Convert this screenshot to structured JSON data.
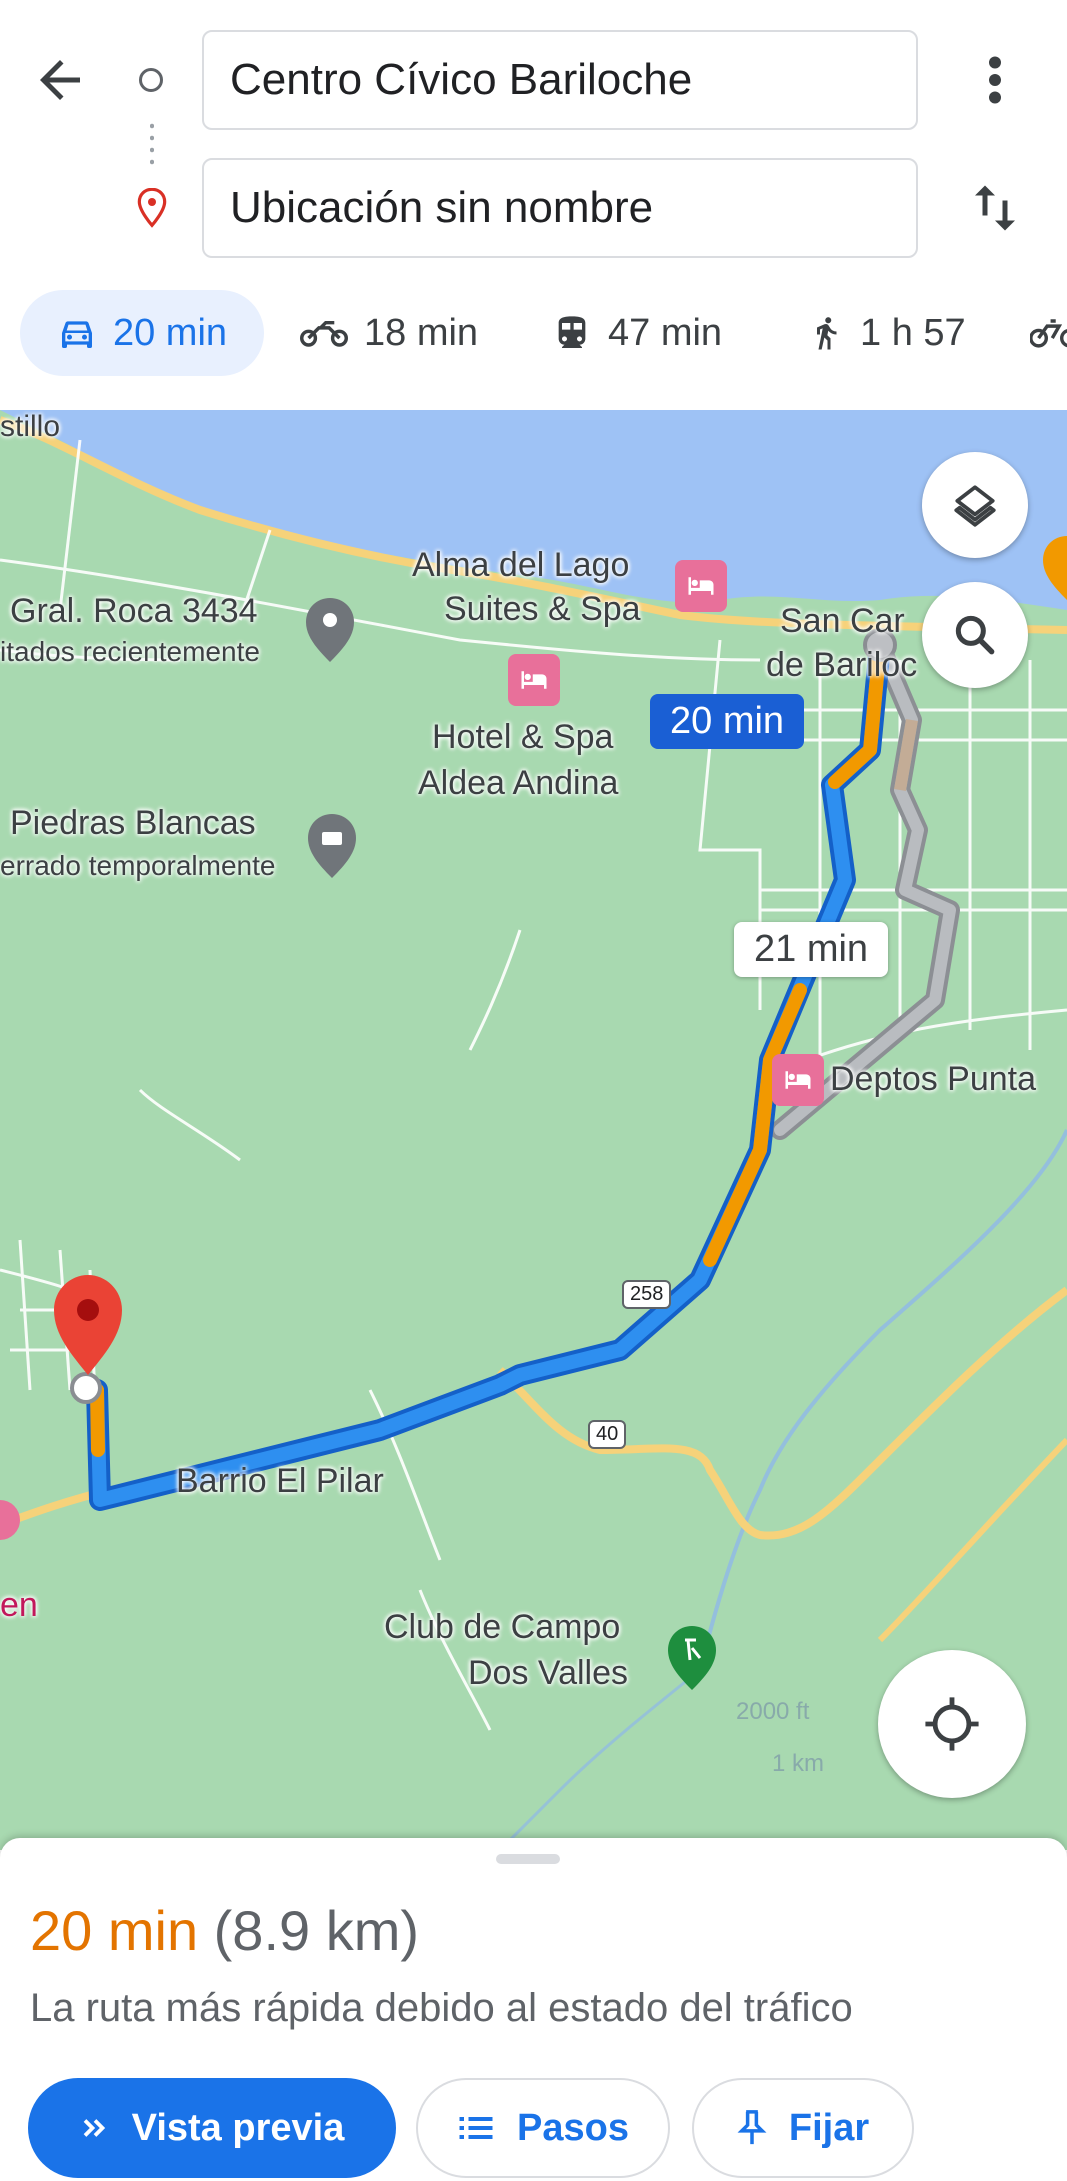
{
  "header": {
    "back_icon": "arrow-back-icon",
    "origin": "Centro Cívico Bariloche",
    "destination": "Ubicación sin nombre",
    "menu_icon": "more-vert-icon",
    "swap_icon": "swap-vert-icon"
  },
  "modes": [
    {
      "icon": "car-icon",
      "label": "20 min",
      "selected": true
    },
    {
      "icon": "motorcycle-icon",
      "label": "18 min"
    },
    {
      "icon": "transit-icon",
      "label": "47 min"
    },
    {
      "icon": "walk-icon",
      "label": "1 h 57"
    },
    {
      "icon": "bicycle-icon",
      "label": ""
    }
  ],
  "map": {
    "labels": {
      "castillo": "stillo",
      "alma1": "Alma del Lago",
      "alma2": "Suites & Spa",
      "gral": "Gral. Roca 3434",
      "visitados": "itados recientemente",
      "sancarlos1": "San Car",
      "sancarlos2": "de Bariloc",
      "hotel1": "Hotel & Spa",
      "hotel2": "Aldea Andina",
      "piedras": "Piedras Blancas",
      "cerrado": "errado temporalmente",
      "deptos": "Deptos Punta",
      "pilar": "Barrio El Pilar",
      "club1": "Club de Campo",
      "club2": "Dos Valles",
      "en": "en"
    },
    "route_main_time": "20 min",
    "route_alt_time": "21 min",
    "road_258": "258",
    "road_40": "40",
    "scale_ft": "2000 ft",
    "scale_km": "1 km",
    "colors": {
      "route": "#1a73e8",
      "traffic": "#f29900",
      "alt_route": "#b0b3b8",
      "water": "#9ec2f5",
      "land": "#a8d9b0",
      "destination_pin": "#ea4335"
    }
  },
  "summary": {
    "time": "20 min",
    "distance": "(8.9 km)",
    "description": "La ruta más rápida debido al estado del tráfico"
  },
  "actions": {
    "preview": "Vista previa",
    "steps": "Pasos",
    "pin": "Fijar"
  }
}
